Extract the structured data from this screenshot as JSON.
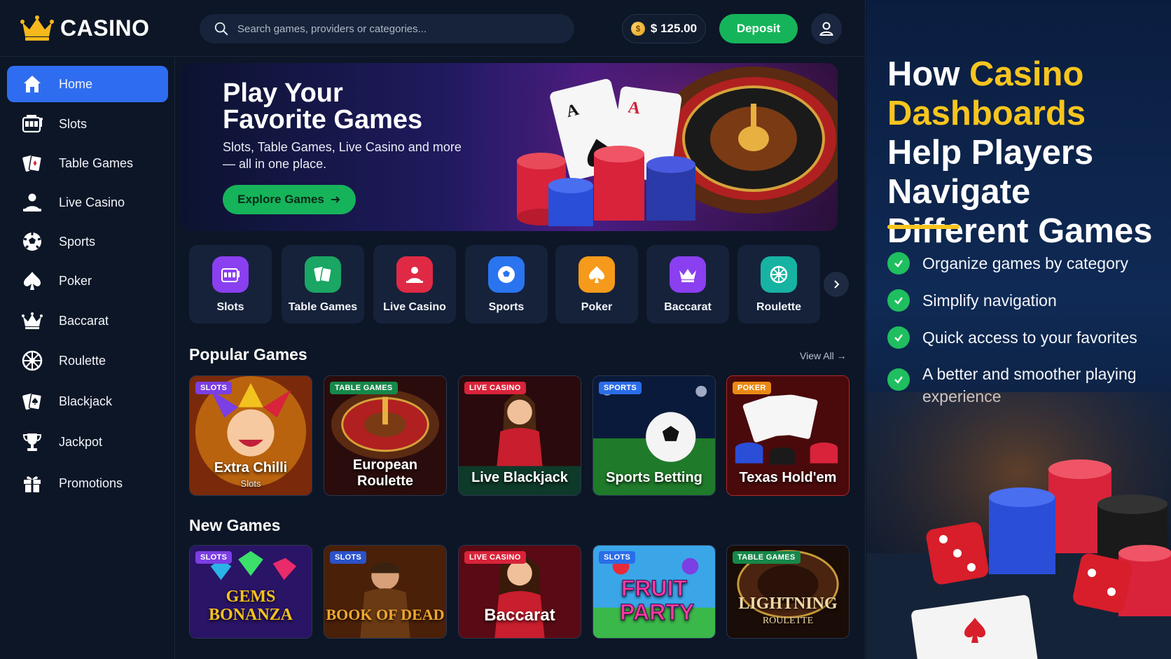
{
  "brand": {
    "name": "CASINO"
  },
  "search": {
    "placeholder": "Search games, providers or categories..."
  },
  "wallet": {
    "balance": "$ 125.00"
  },
  "header": {
    "deposit_label": "Deposit"
  },
  "sidebar": {
    "items": [
      {
        "label": "Home",
        "icon": "home-icon",
        "active": true
      },
      {
        "label": "Slots",
        "icon": "slot-machine-icon"
      },
      {
        "label": "Table Games",
        "icon": "cards-icon"
      },
      {
        "label": "Live Casino",
        "icon": "dealer-icon"
      },
      {
        "label": "Sports",
        "icon": "soccer-ball-icon"
      },
      {
        "label": "Poker",
        "icon": "spade-icon"
      },
      {
        "label": "Baccarat",
        "icon": "crown-icon"
      },
      {
        "label": "Roulette",
        "icon": "roulette-wheel-icon"
      },
      {
        "label": "Blackjack",
        "icon": "cards-icon"
      },
      {
        "label": "Jackpot",
        "icon": "trophy-icon"
      },
      {
        "label": "Promotions",
        "icon": "gift-icon"
      }
    ]
  },
  "hero": {
    "title_line1": "Play Your",
    "title_line2": "Favorite Games",
    "subtitle": "Slots, Table Games, Live Casino and more — all in one place.",
    "cta_label": "Explore Games"
  },
  "categories": [
    {
      "label": "Slots",
      "icon": "slot-machine-icon",
      "color": "#8a3ff0"
    },
    {
      "label": "Table Games",
      "icon": "cards-icon",
      "color": "#1aa663"
    },
    {
      "label": "Live Casino",
      "icon": "dealer-icon",
      "color": "#e02a45"
    },
    {
      "label": "Sports",
      "icon": "soccer-ball-icon",
      "color": "#2a74f0"
    },
    {
      "label": "Poker",
      "icon": "spade-icon",
      "color": "#f59a1b"
    },
    {
      "label": "Baccarat",
      "icon": "crown-icon",
      "color": "#8a3ff0"
    },
    {
      "label": "Roulette",
      "icon": "roulette-wheel-icon",
      "color": "#16b3a2"
    }
  ],
  "popular": {
    "title": "Popular Games",
    "view_all": "View All →",
    "games": [
      {
        "badge": "SLOTS",
        "badge_color": "#7b3fe4",
        "title": "Extra Chilli",
        "subtitle": "Slots"
      },
      {
        "badge": "TABLE GAMES",
        "badge_color": "#16884a",
        "title": "European Roulette"
      },
      {
        "badge": "LIVE CASINO",
        "badge_color": "#d8233a",
        "title": "Live Blackjack"
      },
      {
        "badge": "SPORTS",
        "badge_color": "#2b6de8",
        "title": "Sports Betting"
      },
      {
        "badge": "POKER",
        "badge_color": "#e98a14",
        "title": "Texas Hold'em"
      }
    ]
  },
  "new_games": {
    "title": "New Games",
    "games": [
      {
        "badge": "SLOTS",
        "badge_color": "#7b3fe4",
        "title": "GEMS BONANZA"
      },
      {
        "badge": "SLOTS",
        "badge_color": "#2b52c8",
        "title": "BOOK OF DEAD"
      },
      {
        "badge": "LIVE CASINO",
        "badge_color": "#d8233a",
        "title": "Baccarat"
      },
      {
        "badge": "SLOTS",
        "badge_color": "#2b6de8",
        "title": "FRUIT PARTY"
      },
      {
        "badge": "TABLE GAMES",
        "badge_color": "#16884a",
        "title": "LIGHTNING",
        "subtitle": "ROULETTE"
      }
    ]
  },
  "panel": {
    "title_prefix": "How ",
    "title_highlight": "Casino Dashboards",
    "title_suffix": " Help Players Navigate Different Games",
    "features": [
      "Organize games by category",
      "Simplify navigation",
      "Quick access to your favorites",
      "A better and smoother playing experience"
    ],
    "accent_color": "#f7c51e",
    "check_color": "#1fbf5f"
  }
}
